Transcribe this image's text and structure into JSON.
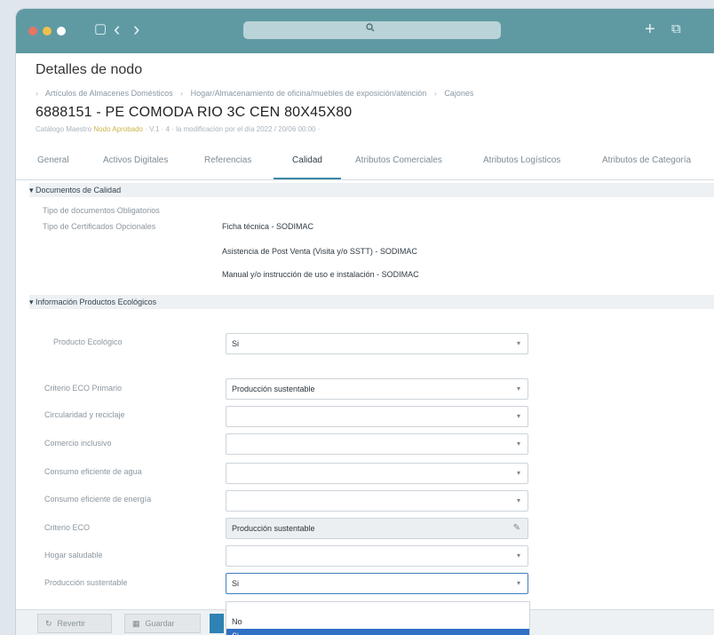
{
  "toolbar": {
    "search_icon": "search-icon",
    "plus": "+",
    "tabs_icon": "⧉",
    "sidebar_icon": "▢",
    "back": "‹",
    "forward": "›"
  },
  "page": {
    "title": "Detalles de nodo",
    "breadcrumb": [
      "Artículos de Almacenes Domésticos",
      "Hogar/Almacenamiento de oficina/muebles de exposición/atención",
      "Cajones"
    ],
    "node_title": "6888151 - PE COMODA RIO 3C CEN 80X45X80",
    "meta_left": "Catálogo Maestro",
    "meta_status": "Nodo Aprobado",
    "meta_right": "· V.1 · 4 · la modificación por el día 2022 / 20/06 00:00 ·"
  },
  "tabs": [
    "General",
    "Activos Digitales",
    "Referencias",
    "Calidad",
    "Atributos Comerciales",
    "Atributos Logísticos",
    "Atributos de Categoría"
  ],
  "active_tab": "Calidad",
  "quality_docs": {
    "section_title": "▾ Documentos de Calidad",
    "label_required": "Tipo de documentos Obligatorios",
    "label_certificates": "Tipo de Certificados Opcionales",
    "documents": [
      "Ficha técnica - SODIMAC",
      "Asistencia de Post Venta (Visita y/o SSTT) - SODIMAC",
      "Manual y/o instrucción de uso e instalación - SODIMAC"
    ]
  },
  "eco_info": {
    "section_title": "▾ Información Productos Ecológicos",
    "fields": [
      {
        "label": "Producto Ecológico",
        "value": "Si"
      },
      {
        "label": "Criterio ECO Primario",
        "value": "Producción sustentable"
      },
      {
        "label": "Circularidad y reciclaje",
        "value": ""
      },
      {
        "label": "Comercio inclusivo",
        "value": ""
      },
      {
        "label": "Consumo eficiente de agua",
        "value": ""
      },
      {
        "label": "Consumo eficiente de energía",
        "value": ""
      },
      {
        "label": "Criterio ECO",
        "value": "Producción sustentable"
      },
      {
        "label": "Hogar saludable",
        "value": ""
      },
      {
        "label": "Producción sustentable",
        "value": "Si"
      }
    ],
    "dropdown_options": [
      "No",
      "Si"
    ],
    "dropdown_selected": "Si"
  },
  "footer": {
    "revert_label": "Revertir",
    "save_label": "Guardar"
  }
}
